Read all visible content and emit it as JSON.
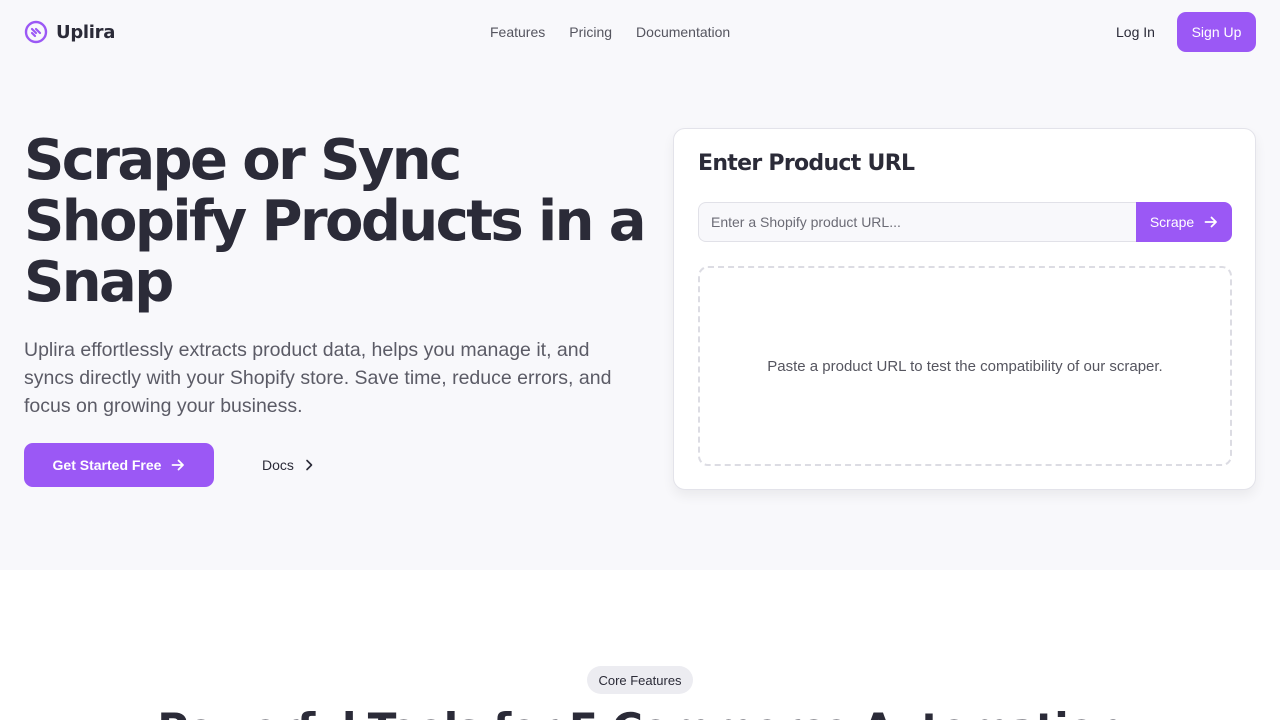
{
  "header": {
    "brand": "Uplira",
    "nav": [
      "Features",
      "Pricing",
      "Documentation"
    ],
    "login": "Log In",
    "signup": "Sign Up"
  },
  "hero": {
    "title": "Scrape or Sync Shopify Products in a Snap",
    "subtitle": "Uplira effortlessly extracts product data, helps you manage it, and syncs directly with your Shopify store. Save time, reduce errors, and focus on growing your business.",
    "cta_label": "Get Started Free",
    "docs_label": "Docs"
  },
  "scraper_card": {
    "title": "Enter Product URL",
    "input_value": "",
    "input_placeholder": "Enter a Shopify product URL...",
    "button_label": "Scrape",
    "empty_message": "Paste a product URL to test the compatibility of our scraper."
  },
  "features": {
    "badge": "Core Features",
    "title": "Powerful Tools for E-Commerce Automation"
  },
  "colors": {
    "accent": "#9b58f5",
    "text": "#2b2b38",
    "hero_bg": "#f8f8fb"
  },
  "icons": {
    "logo": "logo-icon",
    "arrow": "arrow-right-icon",
    "chevron": "chevron-right-icon"
  }
}
